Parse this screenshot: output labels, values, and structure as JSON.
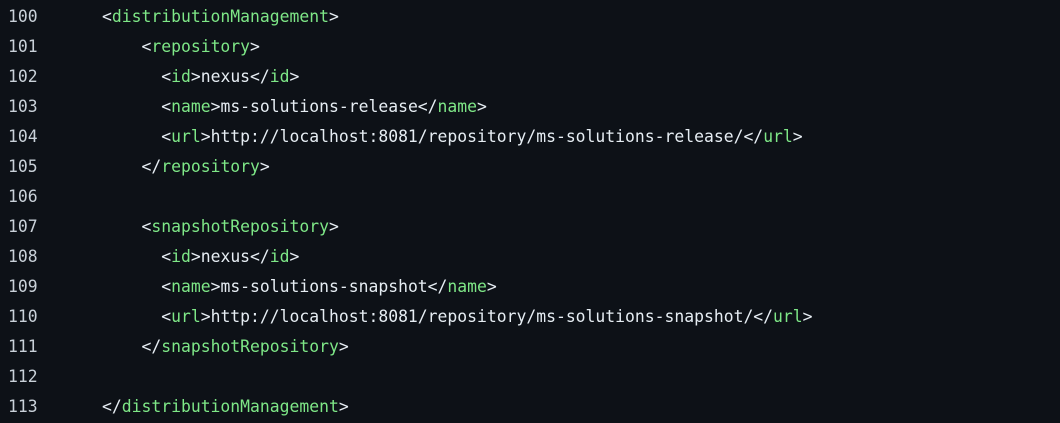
{
  "colors": {
    "background": "#0d1117",
    "tag": "#7ee787",
    "text": "#e6edf3",
    "line_number": "#c9d1d9"
  },
  "lines": [
    {
      "number": "100",
      "indent": "",
      "segments": [
        {
          "t": "<",
          "k": "pun"
        },
        {
          "t": "distributionManagement",
          "k": "tag"
        },
        {
          "t": ">",
          "k": "pun"
        }
      ]
    },
    {
      "number": "101",
      "indent": "    ",
      "segments": [
        {
          "t": "<",
          "k": "pun"
        },
        {
          "t": "repository",
          "k": "tag"
        },
        {
          "t": ">",
          "k": "pun"
        }
      ]
    },
    {
      "number": "102",
      "indent": "      ",
      "segments": [
        {
          "t": "<",
          "k": "pun"
        },
        {
          "t": "id",
          "k": "tag"
        },
        {
          "t": ">nexus</",
          "k": "pun"
        },
        {
          "t": "id",
          "k": "tag"
        },
        {
          "t": ">",
          "k": "pun"
        }
      ]
    },
    {
      "number": "103",
      "indent": "      ",
      "segments": [
        {
          "t": "<",
          "k": "pun"
        },
        {
          "t": "name",
          "k": "tag"
        },
        {
          "t": ">ms-solutions-release</",
          "k": "pun"
        },
        {
          "t": "name",
          "k": "tag"
        },
        {
          "t": ">",
          "k": "pun"
        }
      ]
    },
    {
      "number": "104",
      "indent": "      ",
      "segments": [
        {
          "t": "<",
          "k": "pun"
        },
        {
          "t": "url",
          "k": "tag"
        },
        {
          "t": ">http://localhost:8081/repository/ms-solutions-release/</",
          "k": "pun"
        },
        {
          "t": "url",
          "k": "tag"
        },
        {
          "t": ">",
          "k": "pun"
        }
      ]
    },
    {
      "number": "105",
      "indent": "    ",
      "segments": [
        {
          "t": "</",
          "k": "pun"
        },
        {
          "t": "repository",
          "k": "tag"
        },
        {
          "t": ">",
          "k": "pun"
        }
      ]
    },
    {
      "number": "106",
      "indent": "",
      "segments": []
    },
    {
      "number": "107",
      "indent": "    ",
      "segments": [
        {
          "t": "<",
          "k": "pun"
        },
        {
          "t": "snapshotRepository",
          "k": "tag"
        },
        {
          "t": ">",
          "k": "pun"
        }
      ]
    },
    {
      "number": "108",
      "indent": "      ",
      "segments": [
        {
          "t": "<",
          "k": "pun"
        },
        {
          "t": "id",
          "k": "tag"
        },
        {
          "t": ">nexus</",
          "k": "pun"
        },
        {
          "t": "id",
          "k": "tag"
        },
        {
          "t": ">",
          "k": "pun"
        }
      ]
    },
    {
      "number": "109",
      "indent": "      ",
      "segments": [
        {
          "t": "<",
          "k": "pun"
        },
        {
          "t": "name",
          "k": "tag"
        },
        {
          "t": ">ms-solutions-snapshot</",
          "k": "pun"
        },
        {
          "t": "name",
          "k": "tag"
        },
        {
          "t": ">",
          "k": "pun"
        }
      ]
    },
    {
      "number": "110",
      "indent": "      ",
      "segments": [
        {
          "t": "<",
          "k": "pun"
        },
        {
          "t": "url",
          "k": "tag"
        },
        {
          "t": ">http://localhost:8081/repository/ms-solutions-snapshot/</",
          "k": "pun"
        },
        {
          "t": "url",
          "k": "tag"
        },
        {
          "t": ">",
          "k": "pun"
        }
      ]
    },
    {
      "number": "111",
      "indent": "    ",
      "segments": [
        {
          "t": "</",
          "k": "pun"
        },
        {
          "t": "snapshotRepository",
          "k": "tag"
        },
        {
          "t": ">",
          "k": "pun"
        }
      ]
    },
    {
      "number": "112",
      "indent": "",
      "segments": []
    },
    {
      "number": "113",
      "indent": "",
      "segments": [
        {
          "t": "</",
          "k": "pun"
        },
        {
          "t": "distributionManagement",
          "k": "tag"
        },
        {
          "t": ">",
          "k": "pun"
        }
      ]
    }
  ]
}
